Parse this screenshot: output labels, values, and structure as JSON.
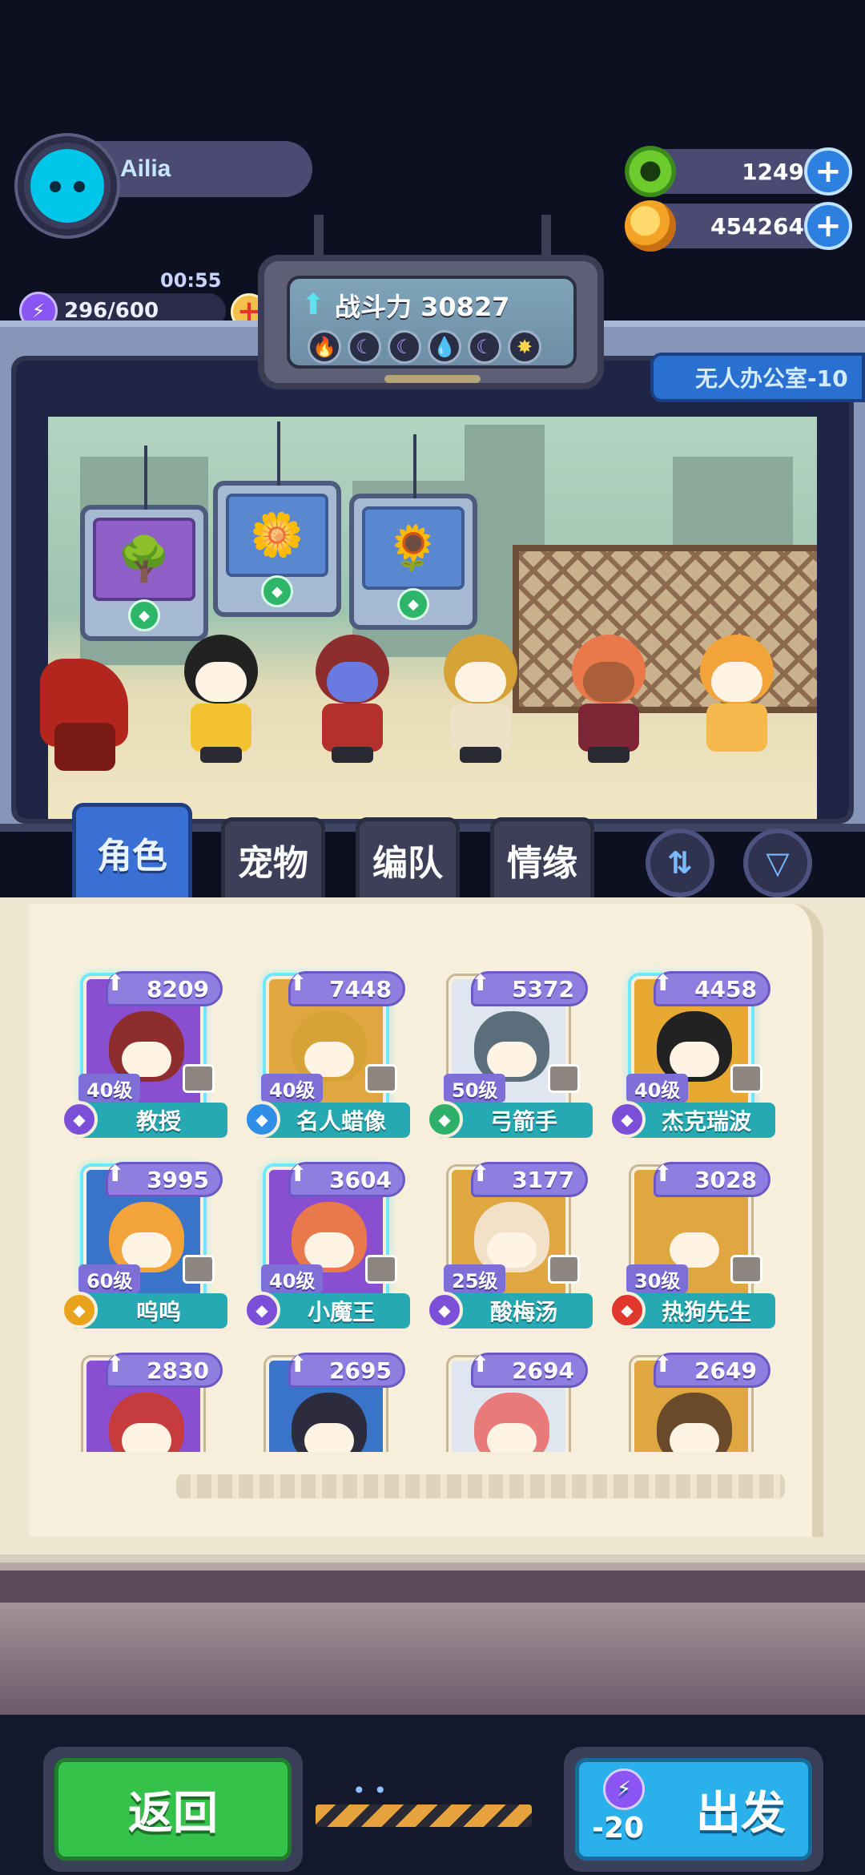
{
  "player": {
    "name": "Ailia",
    "energy_timer": "00:55",
    "energy": "296/600"
  },
  "currencies": [
    {
      "name": "gem",
      "value": "1249"
    },
    {
      "name": "gold",
      "value": "454264"
    }
  ],
  "power_panel": {
    "label": "战斗力 30827",
    "elements": [
      "fire",
      "moon",
      "moon",
      "water",
      "moon",
      "sun"
    ]
  },
  "stage": {
    "room_label": "无人办公室-10",
    "pets": [
      {
        "icon": "tree-icon",
        "badge": "pet-rank-icon"
      },
      {
        "icon": "flower-bush-icon",
        "badge": "pet-rank-icon"
      },
      {
        "icon": "yellow-flower-icon",
        "badge": "pet-rank-icon"
      }
    ]
  },
  "tabs": [
    {
      "id": "characters",
      "label": "角色",
      "active": true
    },
    {
      "id": "pets",
      "label": "宠物",
      "active": false
    },
    {
      "id": "formation",
      "label": "编队",
      "active": false
    },
    {
      "id": "bonds",
      "label": "情缘",
      "active": false
    }
  ],
  "toolbar": {
    "sort_icon": "sort-icon",
    "filter_icon": "filter-icon"
  },
  "characters": [
    {
      "power": "8209",
      "level": "40级",
      "name": "教授",
      "class_color": "#7b4fd8",
      "selected": true
    },
    {
      "power": "7448",
      "level": "40级",
      "name": "名人蜡像",
      "class_color": "#2f8ee8",
      "selected": true
    },
    {
      "power": "5372",
      "level": "50级",
      "name": "弓箭手",
      "class_color": "#2fb06a",
      "selected": false
    },
    {
      "power": "4458",
      "level": "40级",
      "name": "杰克瑞波",
      "class_color": "#7b4fd8",
      "selected": true
    },
    {
      "power": "3995",
      "level": "60级",
      "name": "呜呜",
      "class_color": "#e8a21c",
      "selected": true
    },
    {
      "power": "3604",
      "level": "40级",
      "name": "小魔王",
      "class_color": "#7b4fd8",
      "selected": true
    },
    {
      "power": "3177",
      "level": "25级",
      "name": "酸梅汤",
      "class_color": "#7b4fd8",
      "selected": false
    },
    {
      "power": "3028",
      "level": "30级",
      "name": "热狗先生",
      "class_color": "#e0382c",
      "selected": false
    },
    {
      "power": "2830",
      "level": "",
      "name": "",
      "class_color": "",
      "selected": false
    },
    {
      "power": "2695",
      "level": "",
      "name": "",
      "class_color": "",
      "selected": false
    },
    {
      "power": "2694",
      "level": "",
      "name": "",
      "class_color": "",
      "selected": false
    },
    {
      "power": "2649",
      "level": "",
      "name": "",
      "class_color": "",
      "selected": false
    }
  ],
  "buttons": {
    "back": "返回",
    "depart": "出发",
    "depart_cost": "-20"
  },
  "colors": {
    "active_tab": "#3a6fd4",
    "back_button": "#35c24a",
    "depart_button": "#2ab0ea",
    "name_bar": "#27a9b4",
    "power_badge": "#8f7de0"
  }
}
